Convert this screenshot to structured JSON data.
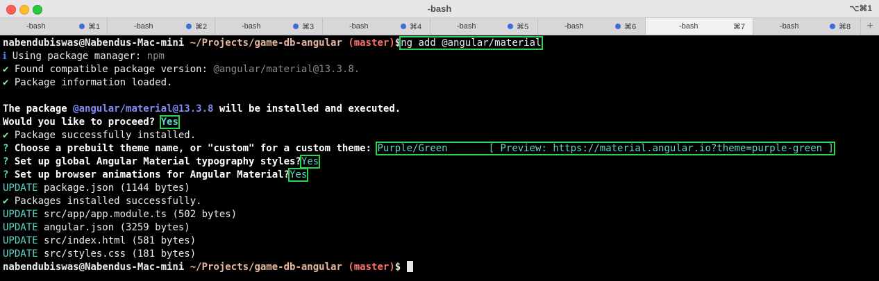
{
  "window": {
    "title": "-bash",
    "shortcut": "⌥⌘1"
  },
  "tabs": [
    {
      "label": "-bash",
      "key": "⌘1",
      "dot": true
    },
    {
      "label": "-bash",
      "key": "⌘2",
      "dot": true
    },
    {
      "label": "-bash",
      "key": "⌘3",
      "dot": true
    },
    {
      "label": "-bash",
      "key": "⌘4",
      "dot": true
    },
    {
      "label": "-bash",
      "key": "⌘5",
      "dot": true
    },
    {
      "label": "-bash",
      "key": "⌘6",
      "dot": true
    },
    {
      "label": "-bash",
      "key": "⌘7",
      "dot": false,
      "active": true
    },
    {
      "label": "-bash",
      "key": "⌘8",
      "dot": true
    }
  ],
  "add_tab": "+",
  "prompt": {
    "user": "nabendubiswas@Nabendus-Mac-mini",
    "path": "~/Projects/game-db-angular",
    "branch": "(master)",
    "symbol": "$"
  },
  "command": "ng add @angular/material",
  "output": {
    "l1_icon": "ℹ",
    "l1": "Using package manager:",
    "l1_val": "npm",
    "l2_icon": "✔",
    "l2": "Found compatible package version:",
    "l2_val": "@angular/material@13.3.8.",
    "l3_icon": "✔",
    "l3": "Package information loaded.",
    "l5_a": "The package",
    "l5_pkg": "@angular/material@13.3.8",
    "l5_b": "will be installed and executed.",
    "l6": "Would you like to proceed?",
    "l6_ans": "Yes",
    "l7_icon": "✔",
    "l7": "Package successfully installed.",
    "q_mark": "?",
    "l8": "Choose a prebuilt theme name, or \"custom\" for a custom theme:",
    "l8_ans": "Purple/Green       [ Preview: https://material.angular.io?theme=purple-green ]",
    "l9": "Set up global Angular Material typography styles?",
    "l9_ans": "Yes",
    "l10": "Set up browser animations for Angular Material?",
    "l10_ans": "Yes",
    "update": "UPDATE",
    "u1": "package.json (1144 bytes)",
    "l12_icon": "✔",
    "l12": "Packages installed successfully.",
    "u2": "src/app/app.module.ts (502 bytes)",
    "u3": "angular.json (3259 bytes)",
    "u4": "src/index.html (581 bytes)",
    "u5": "src/styles.css (181 bytes)"
  }
}
